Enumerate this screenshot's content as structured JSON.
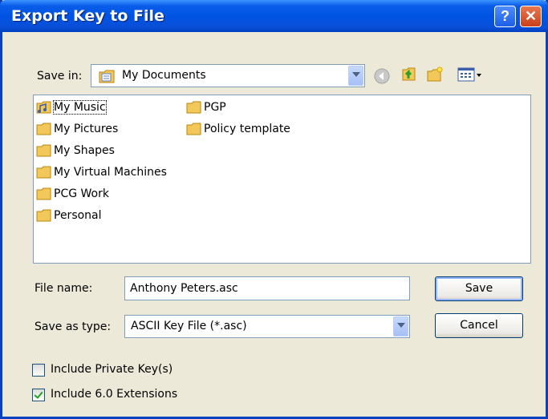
{
  "window": {
    "title": "Export Key to File",
    "help_label": "?",
    "close_label": "✕"
  },
  "save_in": {
    "label": "Save in:",
    "value": "My Documents"
  },
  "files": [
    {
      "name": "My Music",
      "selected": true
    },
    {
      "name": "My Pictures"
    },
    {
      "name": "My Shapes"
    },
    {
      "name": "My Virtual Machines"
    },
    {
      "name": "PCG Work"
    },
    {
      "name": "Personal"
    },
    {
      "name": "PGP"
    },
    {
      "name": "Policy template"
    }
  ],
  "filename": {
    "label": "File name:",
    "value": "Anthony Peters.asc"
  },
  "save_type": {
    "label": "Save as type:",
    "value": "ASCII Key File (*.asc)"
  },
  "buttons": {
    "save": "Save",
    "cancel": "Cancel"
  },
  "options": {
    "private_key": {
      "label": "Include Private Key(s)",
      "checked": false
    },
    "extensions": {
      "label": "Include 6.0 Extensions",
      "checked": true
    }
  },
  "colors": {
    "title_blue": "#0054e3",
    "dialog_bg": "#ece9d8",
    "folder": "#f3c85a"
  }
}
